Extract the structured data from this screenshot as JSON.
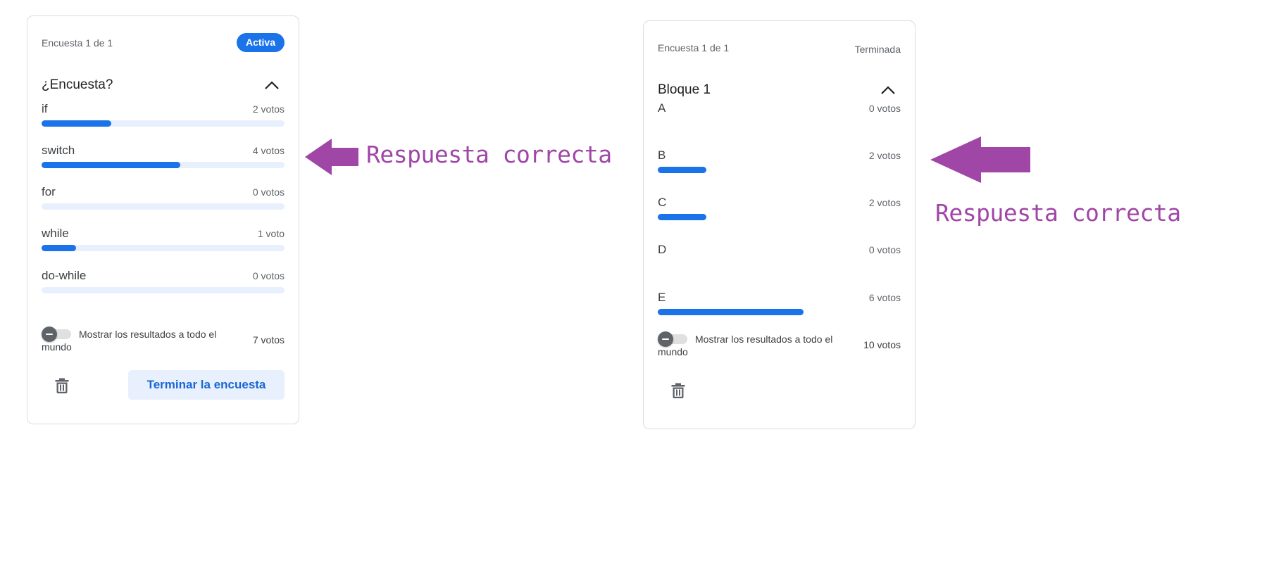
{
  "colors": {
    "accent": "#1a73e8",
    "track": "#e8f0fe",
    "annotation": "#a046a6"
  },
  "polls": [
    {
      "counter": "Encuesta 1 de 1",
      "status": "Activa",
      "title": "¿Encuesta?",
      "options": [
        {
          "label": "if",
          "votes": "2 votos",
          "fraction": 0.2857
        },
        {
          "label": "switch",
          "votes": "4 votos",
          "fraction": 0.5714
        },
        {
          "label": "for",
          "votes": "0 votos",
          "fraction": 0
        },
        {
          "label": "while",
          "votes": "1 voto",
          "fraction": 0.1429
        },
        {
          "label": "do-while",
          "votes": "0 votos",
          "fraction": 0
        }
      ],
      "toggle_label": "Mostrar los resultados a todo el mundo",
      "total_votes": "7 votos",
      "end_button": "Terminar la encuesta"
    },
    {
      "counter": "Encuesta 1 de 1",
      "status": "Terminada",
      "title": "Bloque 1",
      "options": [
        {
          "label": "A",
          "votes": "0 votos",
          "fraction": 0
        },
        {
          "label": "B",
          "votes": "2 votos",
          "fraction": 0.2
        },
        {
          "label": "C",
          "votes": "2 votos",
          "fraction": 0.2
        },
        {
          "label": "D",
          "votes": "0 votos",
          "fraction": 0
        },
        {
          "label": "E",
          "votes": "6 votos",
          "fraction": 0.6
        }
      ],
      "toggle_label": "Mostrar los resultados a todo el mundo",
      "total_votes": "10 votos"
    }
  ],
  "annotations": [
    {
      "text": "Respuesta correcta",
      "icon": "arrow-left-icon"
    },
    {
      "text": "Respuesta correcta",
      "icon": "arrow-left-icon"
    }
  ]
}
